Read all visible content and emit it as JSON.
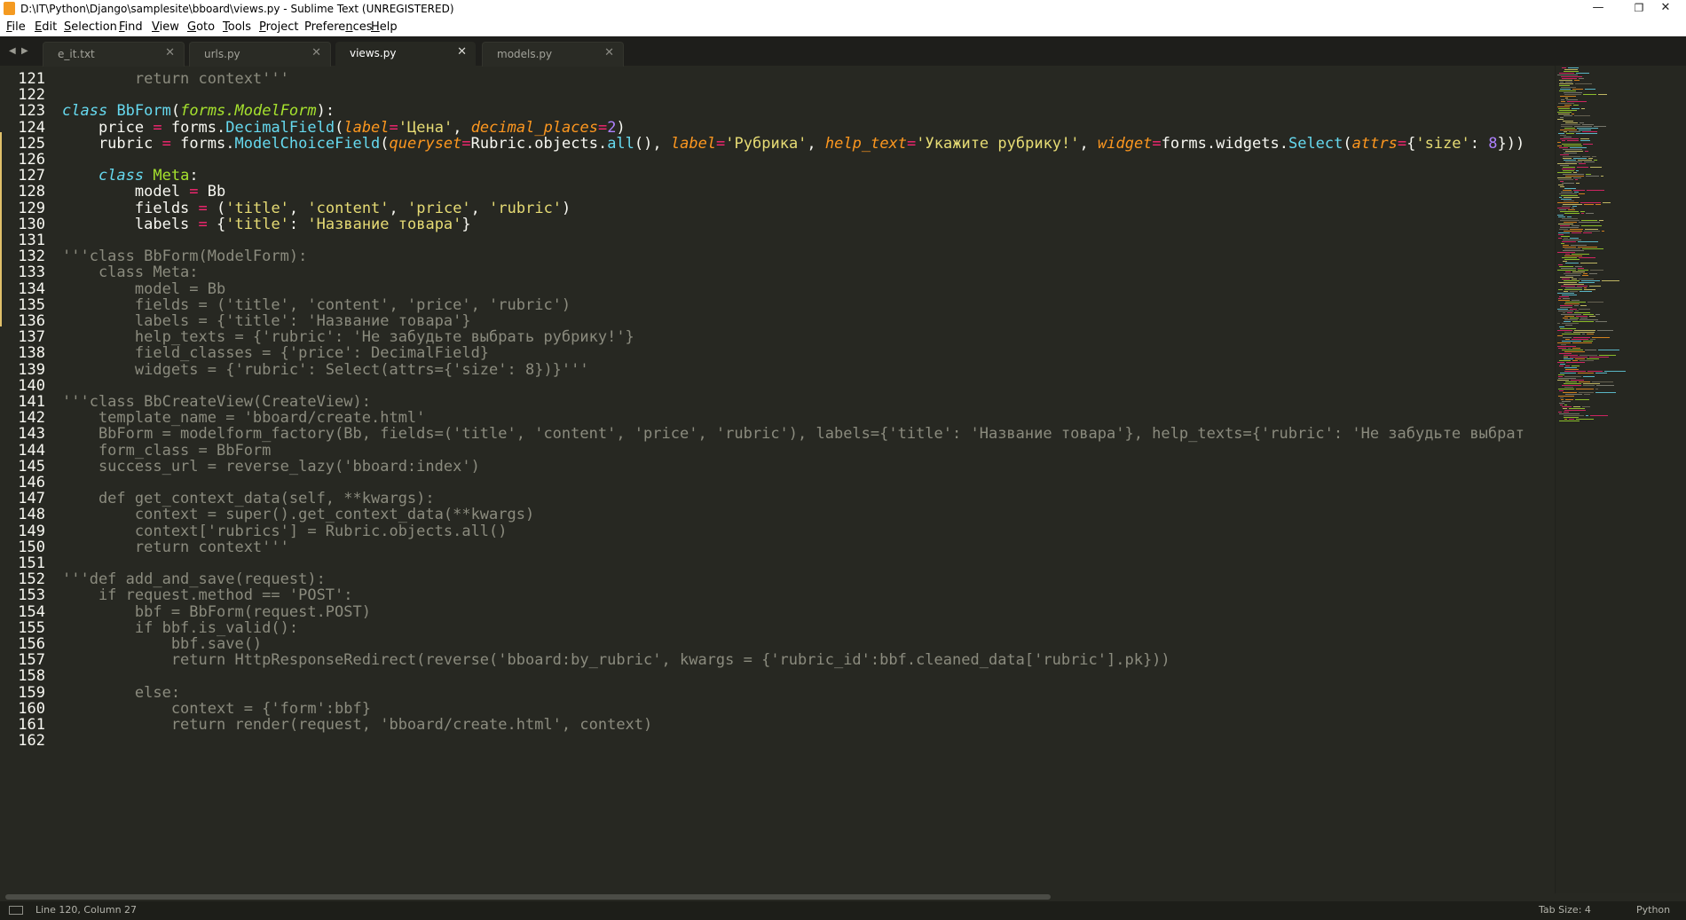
{
  "window": {
    "title": "D:\\IT\\Python\\Django\\samplesite\\bboard\\views.py - Sublime Text (UNREGISTERED)",
    "controls": {
      "minimize": "—",
      "restore": "❐",
      "close": "✕"
    }
  },
  "menu": [
    "File",
    "Edit",
    "Selection",
    "Find",
    "View",
    "Goto",
    "Tools",
    "Project",
    "Preferences",
    "Help"
  ],
  "tabs": [
    {
      "label": "e_it.txt",
      "active": false
    },
    {
      "label": "urls.py",
      "active": false
    },
    {
      "label": "views.py",
      "active": true
    },
    {
      "label": "models.py",
      "active": false
    }
  ],
  "editor": {
    "theme": {
      "background": "#272822",
      "comment": "#75715e",
      "keyword": "#66d9ef",
      "class": "#a6e22e",
      "param": "#fd971f",
      "operator": "#f92672",
      "string": "#e6db74",
      "number": "#ae81ff"
    },
    "lines": [
      {
        "no": "121",
        "text": "        return context'''"
      },
      {
        "no": "122",
        "text": ""
      },
      {
        "no": "123",
        "text": "class BbForm(forms.ModelForm):"
      },
      {
        "no": "124",
        "text": "    price = forms.DecimalField(label='Цена', decimal_places=2)"
      },
      {
        "no": "125",
        "text": "    rubric = forms.ModelChoiceField(queryset=Rubric.objects.all(), label='Рубрика', help_text='Укажите рубрику!', widget=forms.widgets.Select(attrs={'size': 8}))"
      },
      {
        "no": "126",
        "text": ""
      },
      {
        "no": "127",
        "text": "    class Meta:"
      },
      {
        "no": "128",
        "text": "        model = Bb"
      },
      {
        "no": "129",
        "text": "        fields = ('title', 'content', 'price', 'rubric')"
      },
      {
        "no": "130",
        "text": "        labels = {'title': 'Название товара'}"
      },
      {
        "no": "131",
        "text": ""
      },
      {
        "no": "132",
        "text": "'''class BbForm(ModelForm):"
      },
      {
        "no": "133",
        "text": "    class Meta:"
      },
      {
        "no": "134",
        "text": "        model = Bb"
      },
      {
        "no": "135",
        "text": "        fields = ('title', 'content', 'price', 'rubric')"
      },
      {
        "no": "136",
        "text": "        labels = {'title': 'Название товара'}"
      },
      {
        "no": "137",
        "text": "        help_texts = {'rubric': 'Не забудьте выбрать рубрику!'}"
      },
      {
        "no": "138",
        "text": "        field_classes = {'price': DecimalField}"
      },
      {
        "no": "139",
        "text": "        widgets = {'rubric': Select(attrs={'size': 8})}'''"
      },
      {
        "no": "140",
        "text": ""
      },
      {
        "no": "141",
        "text": "'''class BbCreateView(CreateView):"
      },
      {
        "no": "142",
        "text": "    template_name = 'bboard/create.html'"
      },
      {
        "no": "143",
        "text": "    BbForm = modelform_factory(Bb, fields=('title', 'content', 'price', 'rubric'), labels={'title': 'Название товара'}, help_texts={'rubric': 'Не забудьте выбрат"
      },
      {
        "no": "144",
        "text": "    form_class = BbForm"
      },
      {
        "no": "145",
        "text": "    success_url = reverse_lazy('bboard:index')"
      },
      {
        "no": "146",
        "text": ""
      },
      {
        "no": "147",
        "text": "    def get_context_data(self, **kwargs):"
      },
      {
        "no": "148",
        "text": "        context = super().get_context_data(**kwargs)"
      },
      {
        "no": "149",
        "text": "        context['rubrics'] = Rubric.objects.all()"
      },
      {
        "no": "150",
        "text": "        return context'''"
      },
      {
        "no": "151",
        "text": ""
      },
      {
        "no": "152",
        "text": "'''def add_and_save(request):"
      },
      {
        "no": "153",
        "text": "    if request.method == 'POST':"
      },
      {
        "no": "154",
        "text": "        bbf = BbForm(request.POST)"
      },
      {
        "no": "155",
        "text": "        if bbf.is_valid():"
      },
      {
        "no": "156",
        "text": "            bbf.save()"
      },
      {
        "no": "157",
        "text": "            return HttpResponseRedirect(reverse('bboard:by_rubric', kwargs = {'rubric_id':bbf.cleaned_data['rubric'].pk}))"
      },
      {
        "no": "158",
        "text": ""
      },
      {
        "no": "159",
        "text": "        else:"
      },
      {
        "no": "160",
        "text": "            context = {'form':bbf}"
      },
      {
        "no": "161",
        "text": "            return render(request, 'bboard/create.html', context)"
      },
      {
        "no": "162",
        "text": ""
      }
    ]
  },
  "status": {
    "position": "Line 120, Column 27",
    "tab_size": "Tab Size: 4",
    "syntax": "Python"
  }
}
